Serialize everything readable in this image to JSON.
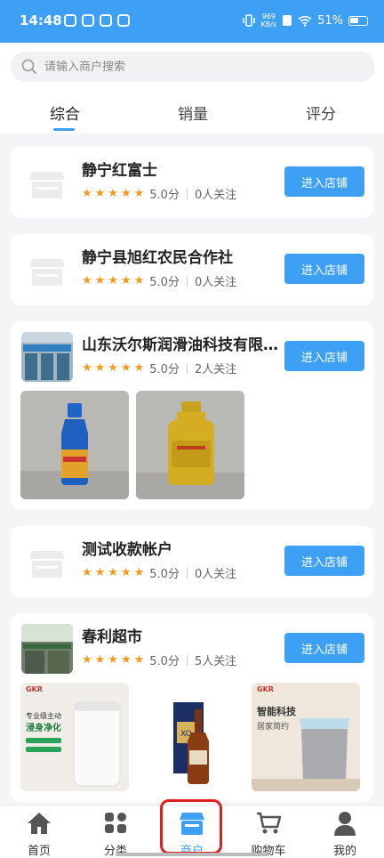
{
  "status_bar": {
    "time": "14:48",
    "net_speed_value": "969",
    "net_speed_unit": "KB/s",
    "battery": "51%"
  },
  "search": {
    "placeholder": "请输入商户搜索"
  },
  "tabs": [
    {
      "label": "综合"
    },
    {
      "label": "销量"
    },
    {
      "label": "评分"
    }
  ],
  "merchants": [
    {
      "name": "静宁红富士",
      "stars": "★★★★★",
      "score": "5.0分",
      "followers": "0人关注",
      "button": "进入店铺"
    },
    {
      "name": "静宁县旭红农民合作社",
      "stars": "★★★★★",
      "score": "5.0分",
      "followers": "0人关注",
      "button": "进入店铺"
    },
    {
      "name": "山东沃尔斯润滑油科技有限公司",
      "stars": "★★★★★",
      "score": "5.0分",
      "followers": "2人关注",
      "button": "进入店铺"
    },
    {
      "name": "测试收款帐户",
      "stars": "★★★★★",
      "score": "5.0分",
      "followers": "0人关注",
      "button": "进入店铺"
    },
    {
      "name": "春利超市",
      "stars": "★★★★★",
      "score": "5.0分",
      "followers": "5人关注",
      "button": "进入店铺"
    }
  ],
  "thumb_texts": {
    "gkr_brand": "GKR",
    "purifier_line1": "专业级主动",
    "purifier_line2": "浸身净化",
    "smart_line1": "智能科技",
    "smart_line2": "居家简约",
    "spirits_label": "XO"
  },
  "nav": [
    {
      "label": "首页",
      "icon": "home-icon"
    },
    {
      "label": "分类",
      "icon": "category-icon"
    },
    {
      "label": "商户",
      "icon": "shop-icon"
    },
    {
      "label": "购物车",
      "icon": "cart-icon"
    },
    {
      "label": "我的",
      "icon": "user-icon"
    }
  ],
  "colors": {
    "accent": "#3da0f5",
    "star": "#f39a1d",
    "highlight": "#e02020"
  }
}
